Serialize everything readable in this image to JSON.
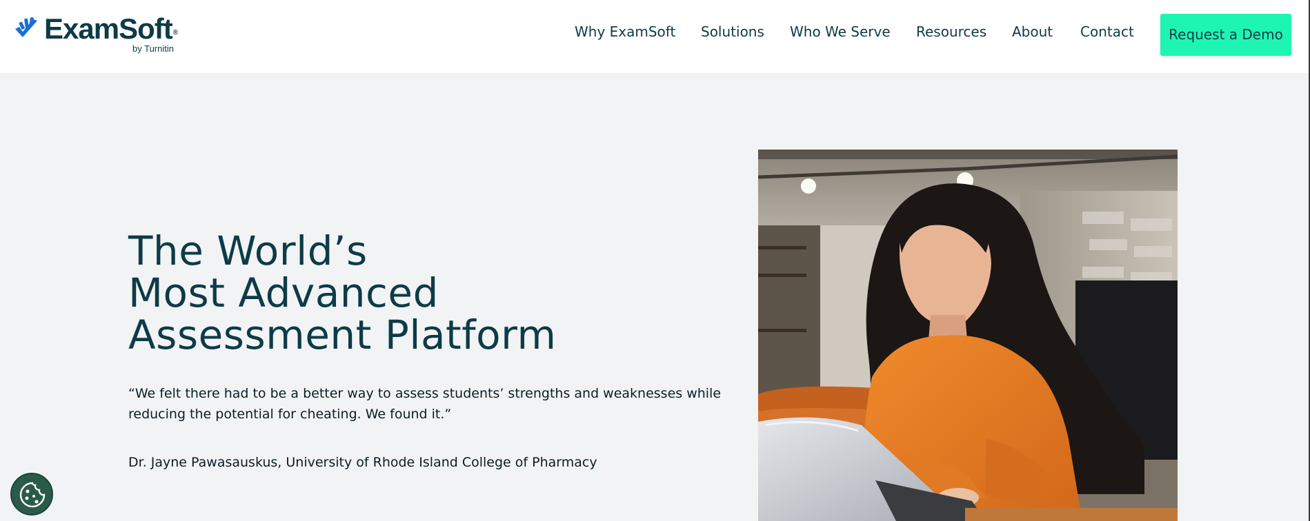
{
  "brand": {
    "name": "ExamSoft",
    "registered": "®",
    "tagline": "by Turnitin",
    "logo_icon": "examsoft-hand-icon"
  },
  "nav": {
    "items": [
      {
        "label": "Why ExamSoft"
      },
      {
        "label": "Solutions"
      },
      {
        "label": "Who We Serve"
      },
      {
        "label": "Resources"
      },
      {
        "label": "About"
      },
      {
        "label": "Contact"
      }
    ],
    "cta_label": "Request a Demo"
  },
  "hero": {
    "title_lines": [
      "The World’s",
      "Most Advanced",
      "Assessment Platform"
    ],
    "quote": "“We felt there had to be a better way to assess students’ strengths and weaknesses while reducing the potential for cheating. We found it.”",
    "attribution": "Dr. Jayne Pawasauskus, University of Rhode Island College of Pharmacy",
    "image": "woman-in-orange-sweater-using-laptop-photo"
  },
  "cookie": {
    "icon": "cookie-icon"
  },
  "colors": {
    "brand_dark": "#0d3b47",
    "brand_blue": "#1a6fd6",
    "cta": "#1ff5b3",
    "page_bg": "#f2f3f5",
    "cookie_bg": "#2a5b48"
  }
}
